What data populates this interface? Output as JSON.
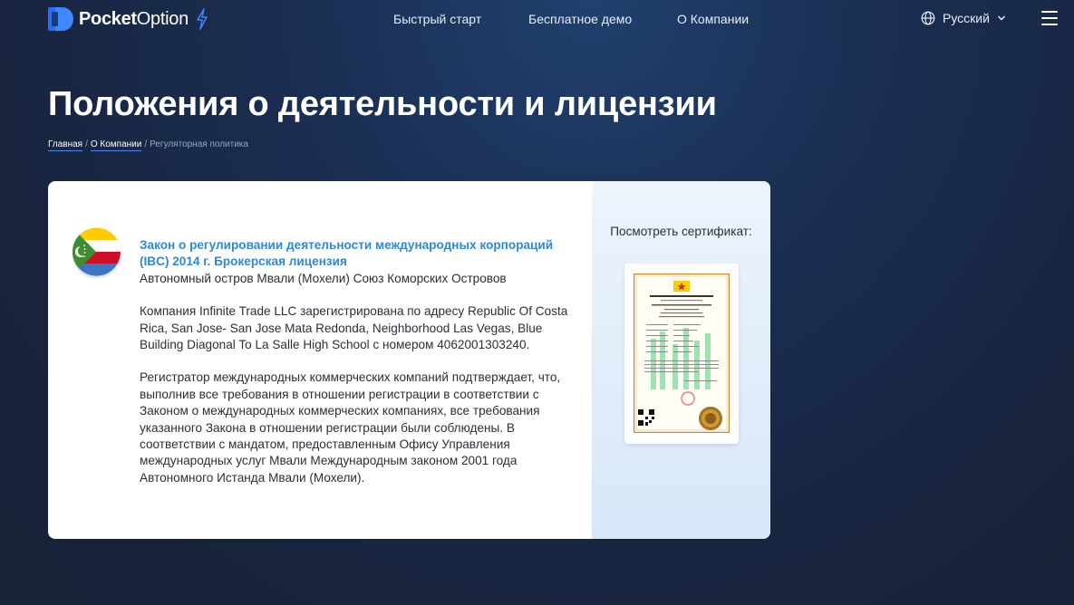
{
  "header": {
    "logo_bold": "Pocket",
    "logo_light": "Option",
    "nav": [
      "Быстрый старт",
      "Бесплатное демо",
      "О Компании"
    ],
    "language": "Русский"
  },
  "page": {
    "title": "Положения о деятельности и лицензии",
    "breadcrumb": {
      "home": "Главная",
      "about": "О Компании",
      "current": "Регуляторная политика",
      "separator": "/"
    }
  },
  "card": {
    "law_title": "Закон о регулировании деятельности международных корпораций (IBC) 2014 г. Брокерская лицензия",
    "jurisdiction": "Автономный остров Мвали (Мохели) Союз Коморских Островов",
    "paragraph1": "Компания Infinite Trade LLC зарегистрирована по адресу Republic Of Costa Rica, San Jose- San Jose Mata Redonda, Neighborhood Las Vegas, Blue Building Diagonal To La Salle High School с номером 4062001303240.",
    "paragraph2": "Регистратор международных коммерческих компаний подтверждает, что, выполнив все требования в отношении регистрации в соответствии с Законом о международных коммерческих компаниях, все требования указанного Закона в отношении регистрации были соблюдены. В соответствии с мандатом, предоставленным Офису Управления международных услуг Мвали Международным законом 2001 года Автономного Истанда Мвали (Мохели).",
    "certificate_label": "Посмотреть сертификат:"
  },
  "colors": {
    "accent_blue": "#2f88d8",
    "background": "#1a2e52"
  }
}
